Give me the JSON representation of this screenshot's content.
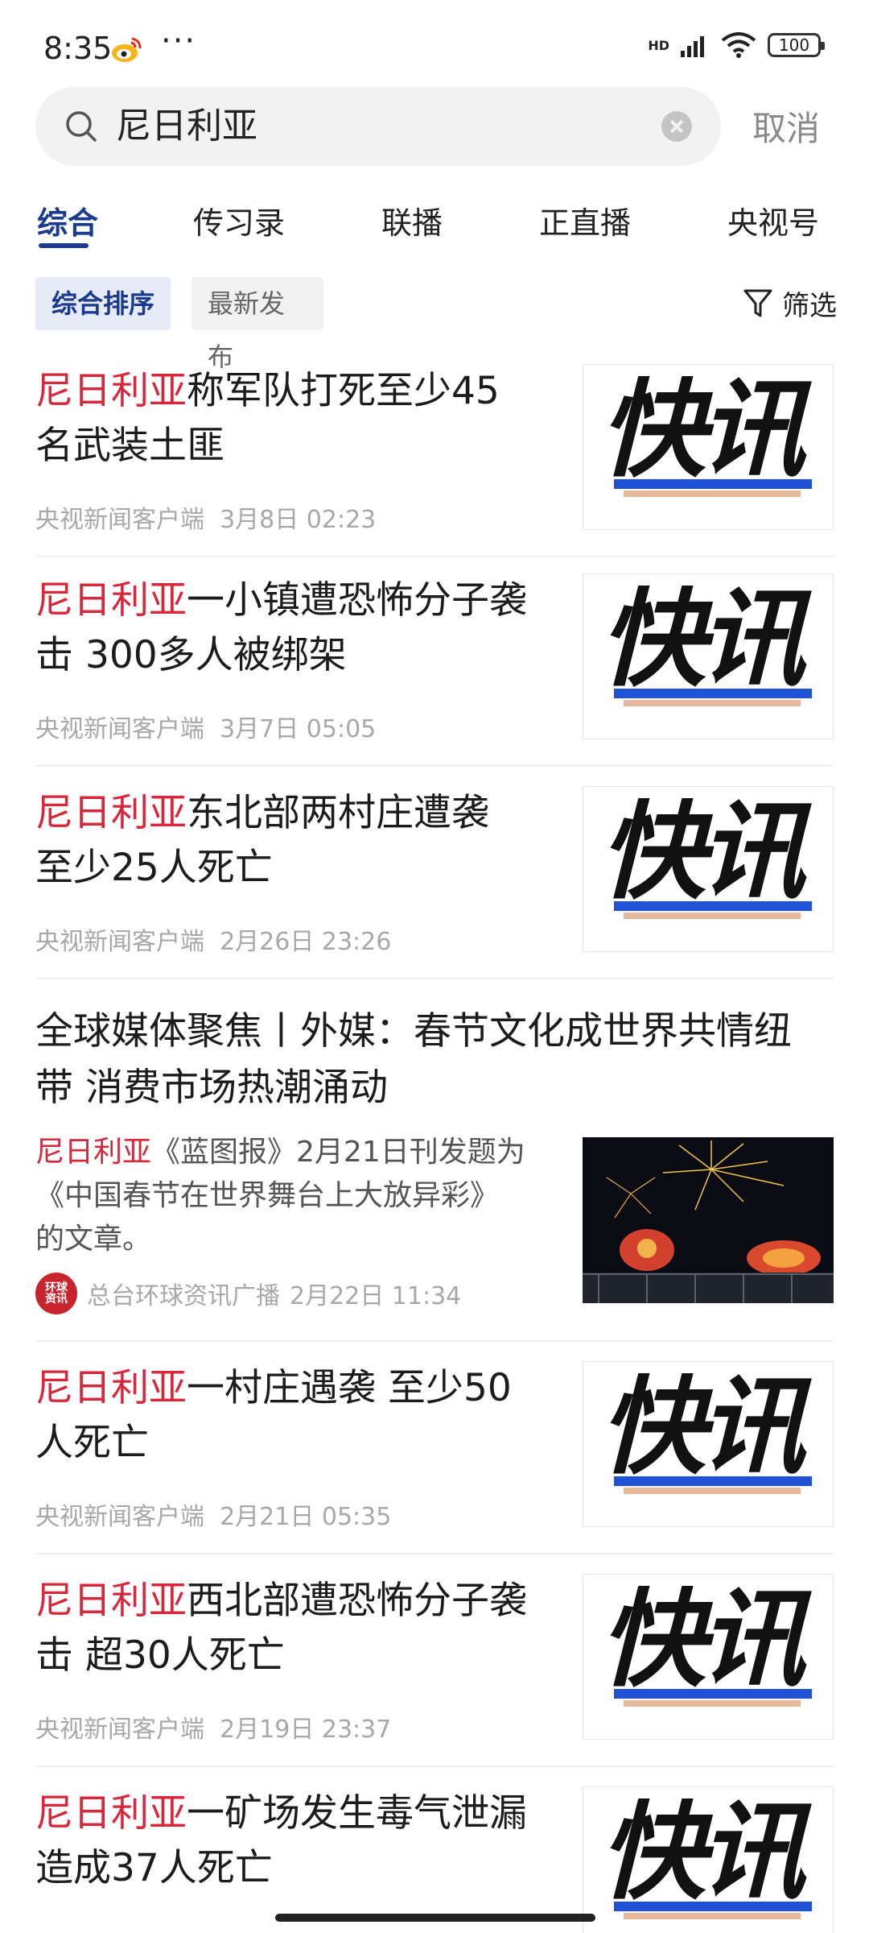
{
  "status_bar": {
    "time": "8:35",
    "more": "···",
    "network": "HD",
    "battery": "100"
  },
  "search": {
    "query": "尼日利亚",
    "cancel_label": "取消"
  },
  "tabs": [
    {
      "label": "综合"
    },
    {
      "label": "传习录"
    },
    {
      "label": "联播"
    },
    {
      "label": "正直播"
    },
    {
      "label": "央视号"
    }
  ],
  "sort": {
    "comprehensive": "综合排序",
    "latest": "最新发布",
    "filter": "筛选"
  },
  "thumb_text": "快讯",
  "news": [
    {
      "highlight": "尼日利亚",
      "rest_line1": "称军队打死至少45",
      "line2": "名武装土匪",
      "source": "央视新闻客户端",
      "time": "3月8日 02:23"
    },
    {
      "highlight": "尼日利亚",
      "rest_line1": "一小镇遭恐怖分子袭",
      "line2": "击 300多人被绑架",
      "source": "央视新闻客户端",
      "time": "3月7日 05:05"
    },
    {
      "highlight": "尼日利亚",
      "rest_line1": "东北部两村庄遭袭",
      "line2": "至少25人死亡",
      "source": "央视新闻客户端",
      "time": "2月26日 23:26"
    },
    {
      "highlight": "尼日利亚",
      "rest_line1": "一村庄遇袭 至少50",
      "line2": "人死亡",
      "source": "央视新闻客户端",
      "time": "2月21日 05:35"
    },
    {
      "highlight": "尼日利亚",
      "rest_line1": "西北部遭恐怖分子袭",
      "line2": "击 超30人死亡",
      "source": "央视新闻客户端",
      "time": "2月19日 23:37"
    },
    {
      "highlight": "尼日利亚",
      "rest_line1": "一矿场发生毒气泄漏",
      "line2": "造成37人死亡",
      "source": "",
      "time": ""
    }
  ],
  "featured": {
    "title_line1": "全球媒体聚焦丨外媒：春节文化成世界共情纽",
    "title_line2": "带 消费市场热潮涌动",
    "summary_highlight": "尼日利亚",
    "summary_line1": "《蓝图报》2月21日刊发题为",
    "summary_line2": "《中国春节在世界舞台上大放异彩》",
    "summary_line3": "的文章。",
    "source_logo_line1": "环球",
    "source_logo_line2": "资讯",
    "source": "总台环球资讯广播",
    "time": "2月22日 11:34"
  }
}
